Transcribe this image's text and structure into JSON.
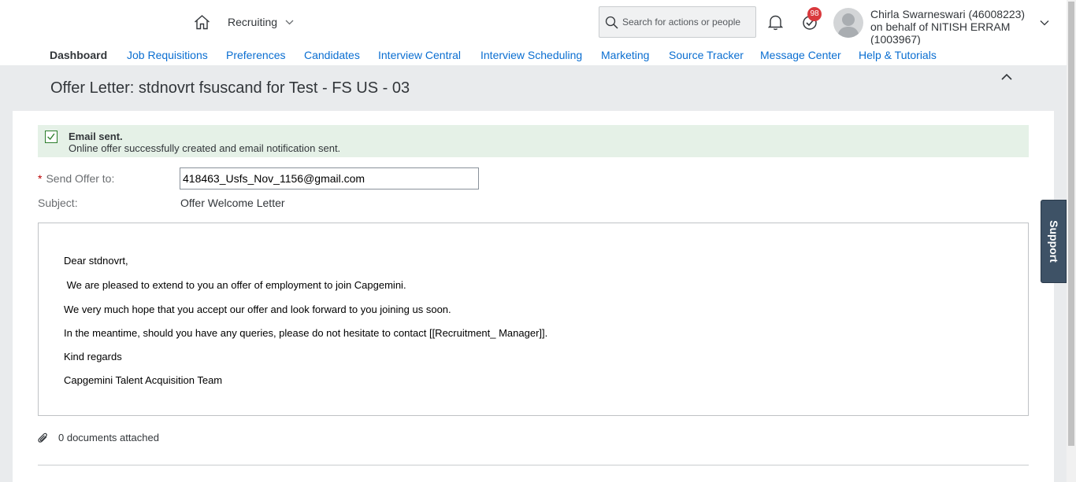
{
  "header": {
    "module": "Recruiting",
    "search_placeholder": "Search for actions or people",
    "todo_badge": "98",
    "user_line1": "Chirla Swarneswari (46008223)",
    "user_line2": "on behalf of NITISH ERRAM",
    "user_line3": "(1003967)"
  },
  "nav": {
    "tabs": [
      {
        "label": "Dashboard",
        "active": true
      },
      {
        "label": "Job Requisitions"
      },
      {
        "label": "Preferences"
      },
      {
        "label": "Candidates"
      },
      {
        "label": "Interview Central"
      },
      {
        "label": "Interview Scheduling"
      },
      {
        "label": "Marketing"
      },
      {
        "label": "Source Tracker"
      },
      {
        "label": "Message Center"
      },
      {
        "label": "Help & Tutorials"
      }
    ]
  },
  "page": {
    "title": "Offer Letter: stdnovrt fsuscand for Test - FS US - 03"
  },
  "message": {
    "title": "Email sent.",
    "body": "Online offer successfully created and email notification sent."
  },
  "form": {
    "required_mark": "*",
    "send_to_label": "Send Offer to:",
    "send_to_value": "418463_Usfs_Nov_1156@gmail.com",
    "subject_label": "Subject:",
    "subject_value": "Offer Welcome Letter"
  },
  "letter": {
    "lines": [
      "Dear stdnovrt,",
      " We are pleased to extend to you an offer of employment to join Capgemini.",
      "We very much hope that you accept our offer and look forward to you joining us soon.",
      "In the meantime, should you have any queries, please do not hesitate to contact [[Recruitment_ Manager]].",
      "Kind regards",
      "Capgemini Talent Acquisition Team"
    ]
  },
  "attachments": {
    "label": "0 documents attached"
  },
  "support": {
    "label": "Support"
  },
  "colors": {
    "link": "#0a6ed1",
    "success_bg": "#e5f1e7",
    "badge": "#d9393d",
    "support_tab": "#3e5266"
  }
}
